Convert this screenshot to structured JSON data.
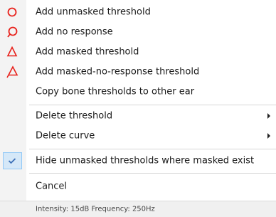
{
  "menu": {
    "items": [
      {
        "label": "Add unmasked threshold",
        "icon": "red-circle-icon"
      },
      {
        "label": "Add no response",
        "icon": "red-circle-with-tail-icon"
      },
      {
        "label": "Add masked threshold",
        "icon": "red-triangle-icon"
      },
      {
        "label": "Add masked-no-response threshold",
        "icon": "red-triangle-with-tail-icon"
      },
      {
        "label": "Copy bone thresholds to other ear"
      },
      {
        "label": "Delete threshold",
        "submenu": true
      },
      {
        "label": "Delete curve",
        "submenu": true
      },
      {
        "label": "Hide unmasked thresholds where masked exist",
        "checked": true,
        "icon": "checkmark-icon"
      },
      {
        "label": "Cancel"
      }
    ]
  },
  "status": {
    "text": "Intensity: 15dB Frequency: 250Hz"
  },
  "colors": {
    "icon_red": "#e8201a",
    "check_blue": "#3b6fb6",
    "highlight_bg": "#d5e8f8",
    "highlight_border": "#90c8f6"
  }
}
